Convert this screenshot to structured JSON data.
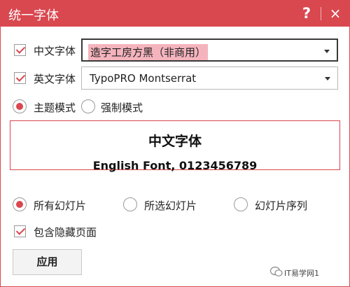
{
  "window": {
    "title": "统一字体",
    "help_label": "?",
    "close_label": "×"
  },
  "chinese_font": {
    "label": "中文字体",
    "checked": true,
    "selected": "造字工房方黑（非商用）"
  },
  "english_font": {
    "label": "英文字体",
    "checked": true,
    "selected": "TypoPRO Montserrat"
  },
  "mode": {
    "options": [
      {
        "label": "主题模式",
        "selected": true
      },
      {
        "label": "强制模式",
        "selected": false
      }
    ]
  },
  "preview": {
    "chinese_text": "中文字体",
    "english_text": "English Font, 0123456789"
  },
  "scope": {
    "options": [
      {
        "label": "所有幻灯片",
        "selected": true
      },
      {
        "label": "所选幻灯片",
        "selected": false
      },
      {
        "label": "幻灯片序列",
        "selected": false
      }
    ]
  },
  "include_hidden": {
    "label": "包含隐藏页面",
    "checked": true
  },
  "apply_button": {
    "label": "应用"
  },
  "watermark": {
    "text": "IT易学网1"
  },
  "colors": {
    "accent": "#d9474f",
    "highlight": "#f5b4bd"
  }
}
